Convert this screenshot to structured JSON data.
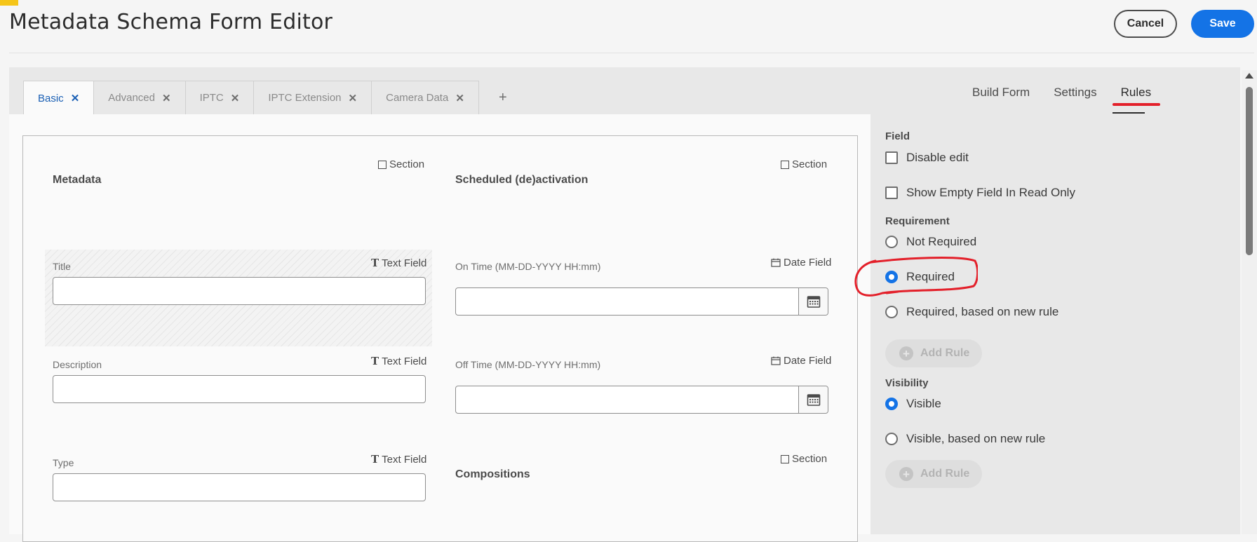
{
  "header": {
    "title": "Metadata Schema Form Editor",
    "cancel_label": "Cancel",
    "save_label": "Save"
  },
  "tabs": [
    {
      "label": "Basic",
      "close": "✕",
      "active": true
    },
    {
      "label": "Advanced",
      "close": "✕"
    },
    {
      "label": "IPTC",
      "close": "✕"
    },
    {
      "label": "IPTC Extension",
      "close": "✕"
    },
    {
      "label": "Camera Data",
      "close": "✕"
    }
  ],
  "add_tab_label": "+",
  "view_tabs": {
    "build_form": "Build Form",
    "settings": "Settings",
    "rules": "Rules"
  },
  "form": {
    "left": {
      "section_badge": "Section",
      "section_title": "Metadata",
      "title_type": "Text Field",
      "title_label": "Title",
      "description_type": "Text Field",
      "description_label": "Description",
      "type_type": "Text Field",
      "type_label": "Type"
    },
    "right": {
      "section_badge": "Section",
      "section_title": "Scheduled (de)activation",
      "on_time_type": "Date Field",
      "on_time_label": "On Time (MM-DD-YYYY HH:mm)",
      "off_time_type": "Date Field",
      "off_time_label": "Off Time (MM-DD-YYYY HH:mm)",
      "compositions_badge": "Section",
      "compositions_title": "Compositions"
    },
    "type_glyph": "T"
  },
  "panel": {
    "field_title": "Field",
    "disable_edit": "Disable edit",
    "show_empty": "Show Empty Field In Read Only",
    "requirement_title": "Requirement",
    "not_required": "Not Required",
    "required": "Required",
    "required_rule": "Required, based on new rule",
    "add_rule_1": "Add Rule",
    "visibility_title": "Visibility",
    "visible": "Visible",
    "visible_rule": "Visible, based on new rule",
    "add_rule_2": "Add Rule",
    "plus_glyph": "+"
  },
  "colors": {
    "accent": "#1473e6",
    "annotation": "#e3202a"
  }
}
